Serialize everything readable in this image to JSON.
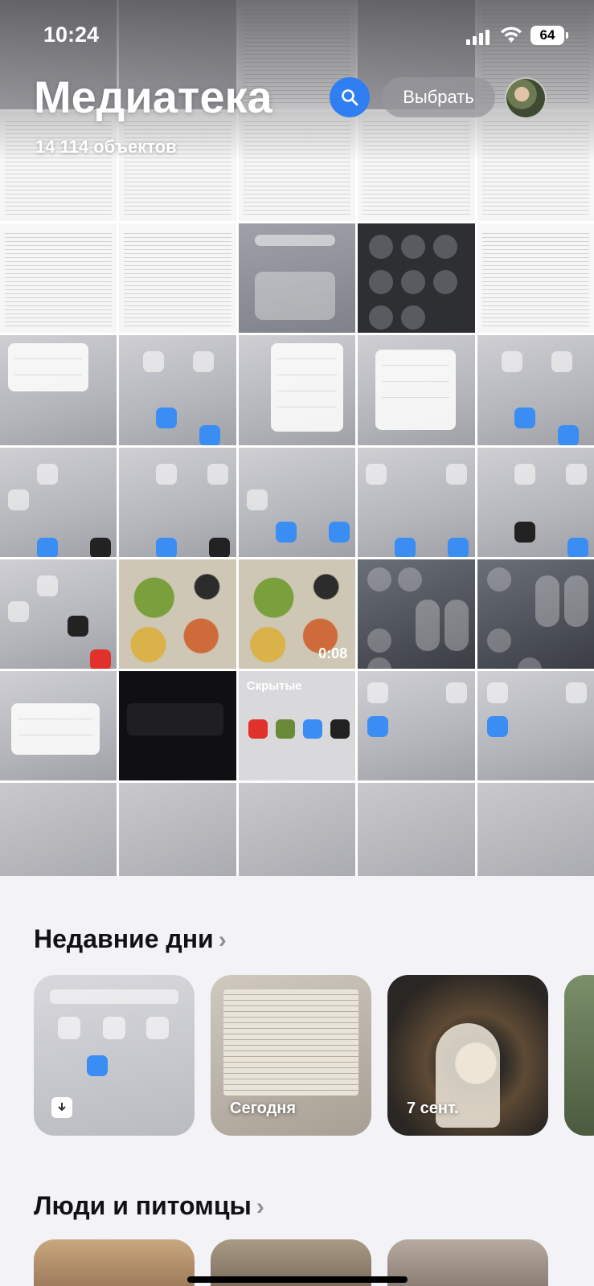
{
  "status_bar": {
    "time": "10:24",
    "battery": "64"
  },
  "header": {
    "title": "Медиатека",
    "count": "14 114 объектов",
    "select_label": "Выбрать",
    "search_icon": "magnifier-icon"
  },
  "grid": {
    "video_duration": "0:08",
    "hidden_album_label": "Скрытые"
  },
  "sections": {
    "recent_days": {
      "title": "Недавние дни",
      "cards": [
        {
          "label": ""
        },
        {
          "label": "Сегодня"
        },
        {
          "label": "7 сент."
        }
      ]
    },
    "people": {
      "title": "Люди и питомцы"
    }
  },
  "colors": {
    "accent": "#2f7ff2",
    "background": "#f2f2f7"
  }
}
